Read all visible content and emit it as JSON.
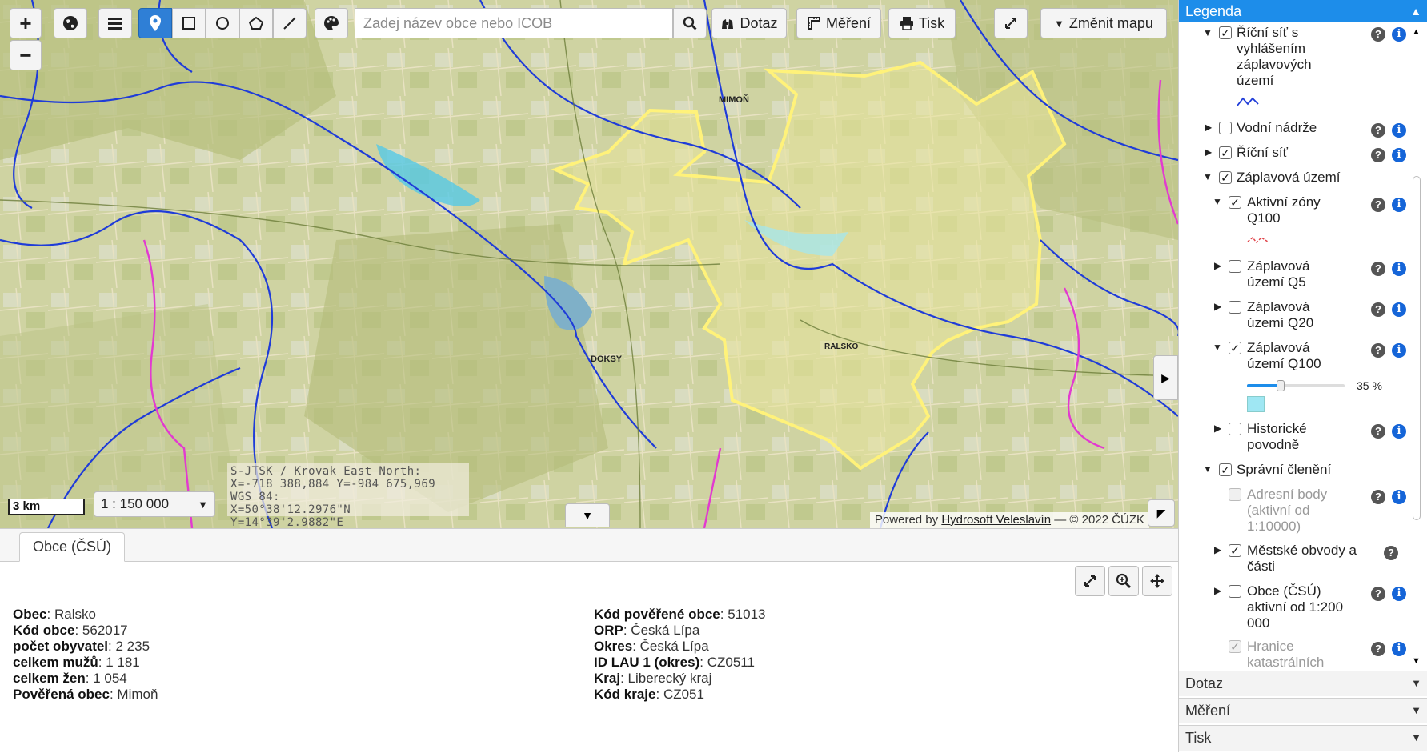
{
  "map": {
    "search_placeholder": "Zadej název obce nebo ICOB",
    "toolbar": {
      "zoom_in": "+",
      "zoom_out": "−",
      "query_label": "Dotaz",
      "measure_label": "Měření",
      "print_label": "Tisk",
      "change_map_label": "Změnit mapu"
    },
    "coords": {
      "line1": "S-JTSK / Krovak East North:",
      "line2": "X=-718 388,884 Y=-984 675,969",
      "line3": "WGS 84:",
      "line4": "X=50°38'12.2976\"N Y=14°39'2.9882\"E"
    },
    "scale_bar": "3 km",
    "scale_select": "1 : 150 000",
    "attribution": {
      "prefix": "Powered by",
      "link": "Hydrosoft Veleslavín",
      "suffix": "— © 2022 ČÚZK"
    },
    "place_labels": {
      "mimon": "MIMOŇ",
      "doksy": "DOKSY",
      "ralsko": "RALSKO"
    }
  },
  "bottom": {
    "tab": "Obce (ČSÚ)",
    "left": [
      {
        "k": "Obec",
        "v": "Ralsko"
      },
      {
        "k": "Kód obce",
        "v": "562017"
      },
      {
        "k": "počet obyvatel",
        "v": "2 235"
      },
      {
        "k": "celkem mužů",
        "v": "1 181"
      },
      {
        "k": "celkem žen",
        "v": "1 054"
      },
      {
        "k": "Pověřená obec",
        "v": "Mimoň"
      }
    ],
    "right": [
      {
        "k": "Kód pověřené obce",
        "v": "51013"
      },
      {
        "k": "ORP",
        "v": "Česká Lípa"
      },
      {
        "k": "Okres",
        "v": "Česká Lípa"
      },
      {
        "k": "ID LAU 1 (okres)",
        "v": "CZ0511"
      },
      {
        "k": "Kraj",
        "v": "Liberecký kraj"
      },
      {
        "k": "Kód kraje",
        "v": "CZ051"
      }
    ]
  },
  "legend": {
    "title": "Legenda",
    "items": {
      "river_flood": "Říční síť s vyhlášením záplavových území",
      "reservoirs": "Vodní nádrže",
      "river_net": "Říční síť",
      "flood_zones": "Záplavová území",
      "active_q100": "Aktivní zóny Q100",
      "flood_q5": "Záplavová území Q5",
      "flood_q20": "Záplavová území Q20",
      "flood_q100": "Záplavová území Q100",
      "opacity": "35 %",
      "historic": "Historické povodně",
      "admin": "Správní členění",
      "addr": "Adresní body (aktivní od 1:10000)",
      "districts": "Městské obvody a části",
      "municipalities": "Obce (ČSÚ) aktivní od 1:200 000",
      "cadastral": "Hranice katastrálních"
    },
    "accordions": [
      "Dotaz",
      "Měření",
      "Tisk"
    ]
  },
  "colors": {
    "accent": "#1d8dea",
    "boundary": "#fff27a",
    "river": "#1f3cd8",
    "admin_border": "#e23ad0",
    "flood_fill": "#9fe7f3"
  }
}
